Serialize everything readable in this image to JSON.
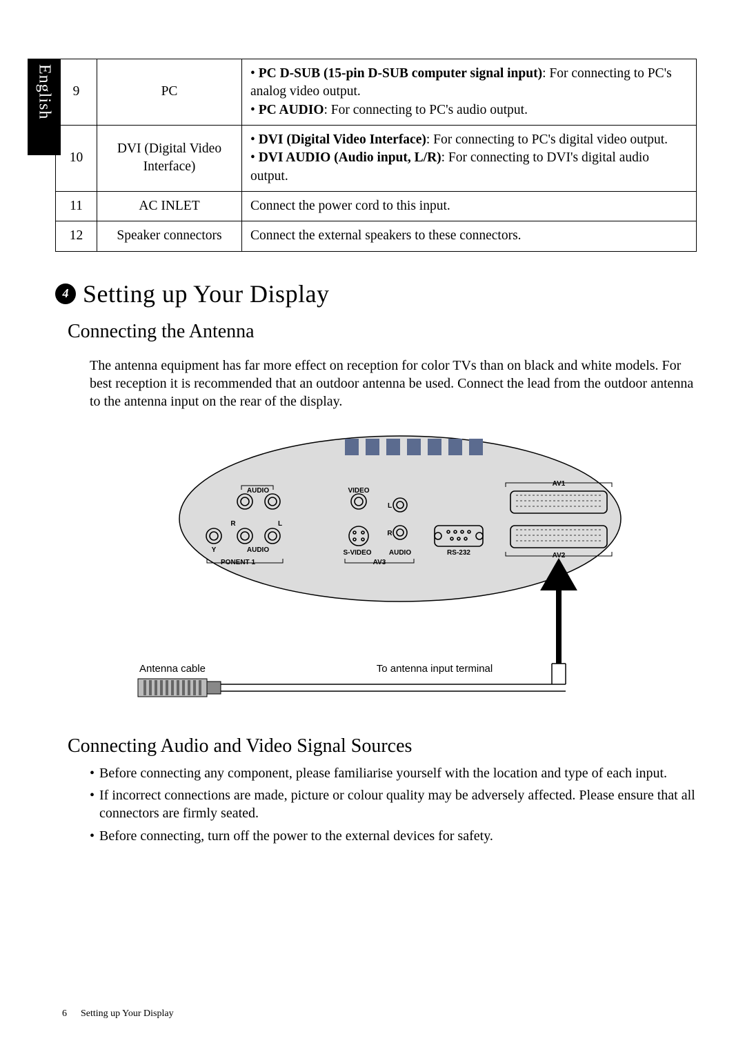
{
  "lang_tab": "English",
  "table": {
    "rows": [
      {
        "num": "9",
        "name": "PC",
        "desc_parts": [
          {
            "b": "PC D-SUB (15-pin D-SUB computer signal input)",
            "t": ": For connecting to PC's analog video output."
          },
          {
            "b": "PC AUDIO",
            "t": ": For connecting to PC's audio output."
          }
        ]
      },
      {
        "num": "10",
        "name": "DVI (Digital Video Interface)",
        "desc_parts": [
          {
            "b": "DVI (Digital Video Interface)",
            "t": ": For connecting to PC's digital video output."
          },
          {
            "b": "DVI AUDIO (Audio input, L/R)",
            "t": ": For connecting to DVI's digital audio output."
          }
        ]
      },
      {
        "num": "11",
        "name": "AC INLET",
        "desc_plain": "Connect the power cord to this input."
      },
      {
        "num": "12",
        "name": "Speaker connectors",
        "desc_plain": "Connect the external speakers to these connectors."
      }
    ]
  },
  "section": {
    "number": "4",
    "title": "Setting up Your Display",
    "sub1": {
      "title": "Connecting the Antenna",
      "paragraph": "The antenna equipment has far more effect on reception for color TVs than on black and white models. For best reception it is recommended that an outdoor antenna be used. Connect the lead from the outdoor antenna to the antenna input on the rear of the display."
    },
    "sub2": {
      "title": "Connecting Audio and Video Signal Sources",
      "bullets": [
        "Before connecting any component, please familiarise yourself with the location and type of each input.",
        "If incorrect connections are made, picture or colour quality may be adversely affected. Please ensure that all connectors are firmly seated.",
        "Before connecting, turn off the power to the external devices for safety."
      ]
    }
  },
  "diagram": {
    "labels": {
      "audio": "AUDIO",
      "video": "VIDEO",
      "l": "L",
      "r": "R",
      "y": "Y",
      "svideo": "S-VIDEO",
      "rs232": "RS-232",
      "av1": "AV1",
      "av2": "AV2",
      "av3": "AV3",
      "ponent1": "PONENT 1",
      "antenna_cable": "Antenna cable",
      "to_terminal": "To antenna input terminal"
    }
  },
  "footer": {
    "page": "6",
    "text": "Setting up Your Display"
  }
}
